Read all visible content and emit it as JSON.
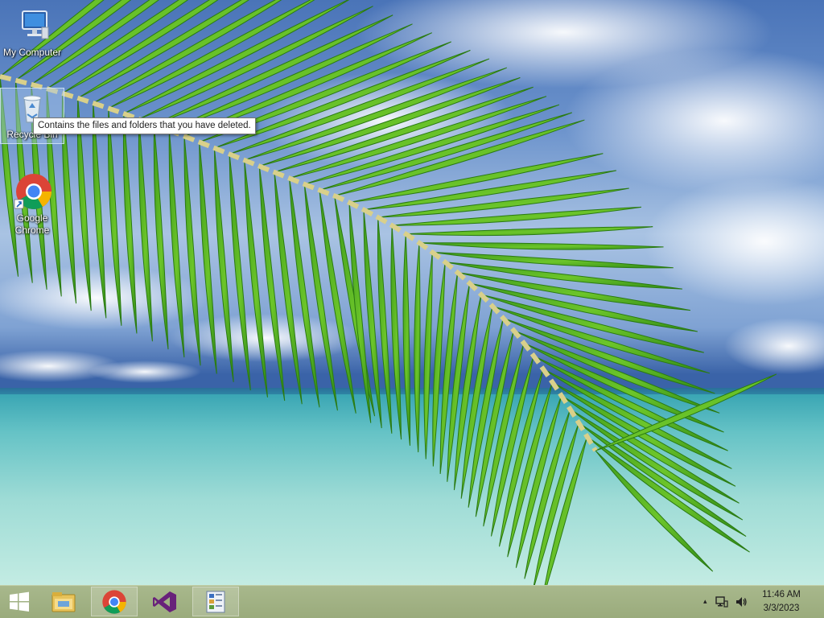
{
  "desktop": {
    "icons": [
      {
        "label": "My Computer",
        "icon": "computer-icon"
      },
      {
        "label": "Recycle Bin",
        "icon": "recycle-bin-icon"
      },
      {
        "label_line1": "Google",
        "label_line2": "Chrome",
        "icon": "chrome-icon"
      }
    ],
    "tooltip": "Contains the files and folders that you have deleted."
  },
  "taskbar": {
    "start": "windows-logo-icon",
    "pinned": [
      {
        "name": "File Explorer",
        "icon": "file-explorer-icon",
        "running": false
      },
      {
        "name": "Google Chrome",
        "icon": "chrome-icon",
        "running": true
      },
      {
        "name": "Visual Studio",
        "icon": "visual-studio-icon",
        "running": false
      },
      {
        "name": "App",
        "icon": "app-icon",
        "running": true
      }
    ],
    "tray": {
      "chevron": "▴",
      "icons": [
        "network-icon",
        "volume-icon"
      ]
    },
    "clock": {
      "time": "11:46 AM",
      "date": "3/3/2023"
    }
  },
  "colors": {
    "taskbar": "#a8b88c",
    "vs_purple": "#68217a",
    "chrome_red": "#db4437",
    "chrome_green": "#0f9d58",
    "chrome_yellow": "#f4b400",
    "chrome_blue": "#4285f4"
  }
}
